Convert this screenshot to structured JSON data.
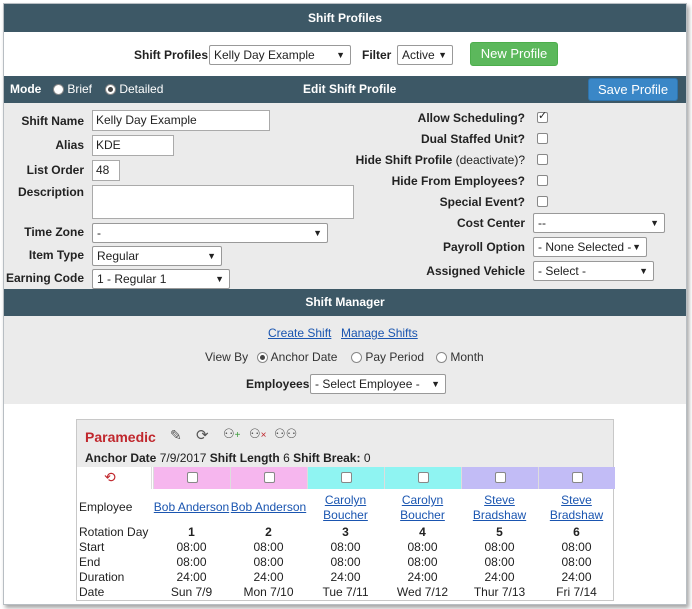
{
  "header": {
    "title": "Shift Profiles"
  },
  "profile_bar": {
    "profiles_label": "Shift Profiles",
    "profile_selected": "Kelly Day Example",
    "filter_label": "Filter",
    "filter_selected": "Active",
    "new_profile_label": "New Profile"
  },
  "edit_bar": {
    "mode_label": "Mode",
    "mode_options": [
      "Brief",
      "Detailed"
    ],
    "mode_selected": "Detailed",
    "title": "Edit Shift Profile",
    "save_label": "Save Profile"
  },
  "form_left": {
    "shift_name_label": "Shift Name",
    "shift_name_value": "Kelly Day Example",
    "alias_label": "Alias",
    "alias_value": "KDE",
    "list_order_label": "List Order",
    "list_order_value": "48",
    "description_label": "Description",
    "description_value": "",
    "time_zone_label": "Time Zone",
    "time_zone_value": "-",
    "item_type_label": "Item Type",
    "item_type_value": "Regular",
    "earning_code_label": "Earning Code",
    "earning_code_value": "1 - Regular 1"
  },
  "form_right": {
    "allow_scheduling_label": "Allow Scheduling?",
    "allow_scheduling_checked": true,
    "dual_staffed_label": "Dual Staffed Unit?",
    "hide_profile_label": "Hide Shift Profile",
    "hide_profile_sub": "(deactivate)?",
    "hide_from_employees_label": "Hide From Employees?",
    "special_event_label": "Special Event?",
    "cost_center_label": "Cost Center",
    "cost_center_value": "--",
    "payroll_option_label": "Payroll Option",
    "payroll_option_value": "- None Selected -",
    "assigned_vehicle_label": "Assigned Vehicle",
    "assigned_vehicle_value": "- Select -"
  },
  "shift_manager": {
    "title": "Shift Manager",
    "create_shift": "Create Shift",
    "manage_shifts": "Manage Shifts",
    "view_by_label": "View By",
    "view_options": [
      "Anchor Date",
      "Pay Period",
      "Month"
    ],
    "view_selected": "Anchor Date",
    "employees_label": "Employees",
    "employees_value": "- Select Employee -"
  },
  "grid": {
    "title": "Paramedic",
    "title_color": "#c0272d",
    "anchor_label": "Anchor Date",
    "anchor_value": "7/9/2017",
    "length_label": "Shift Length",
    "length_value": "6",
    "break_label": "Shift Break:",
    "break_value": "0",
    "row_labels": {
      "employee": "Employee",
      "rotation_day": "Rotation Day",
      "start": "Start",
      "end": "End",
      "duration": "Duration",
      "date": "Date"
    },
    "columns": [
      {
        "color": "#f6b6ee",
        "employee": "Bob Anderson",
        "day": "1",
        "start": "08:00",
        "end": "08:00",
        "duration": "24:00",
        "date": "Sun 7/9"
      },
      {
        "color": "#f6b6ee",
        "employee": "Bob Anderson",
        "day": "2",
        "start": "08:00",
        "end": "08:00",
        "duration": "24:00",
        "date": "Mon 7/10"
      },
      {
        "color": "#8ff4f2",
        "employee": "Carolyn Boucher",
        "day": "3",
        "start": "08:00",
        "end": "08:00",
        "duration": "24:00",
        "date": "Tue 7/11"
      },
      {
        "color": "#8ff4f2",
        "employee": "Carolyn Boucher",
        "day": "4",
        "start": "08:00",
        "end": "08:00",
        "duration": "24:00",
        "date": "Wed 7/12"
      },
      {
        "color": "#c2bcf6",
        "employee": "Steve Bradshaw",
        "day": "5",
        "start": "08:00",
        "end": "08:00",
        "duration": "24:00",
        "date": "Thur 7/13"
      },
      {
        "color": "#c2bcf6",
        "employee": "Steve Bradshaw",
        "day": "6",
        "start": "08:00",
        "end": "08:00",
        "duration": "24:00",
        "date": "Fri 7/14"
      }
    ]
  }
}
